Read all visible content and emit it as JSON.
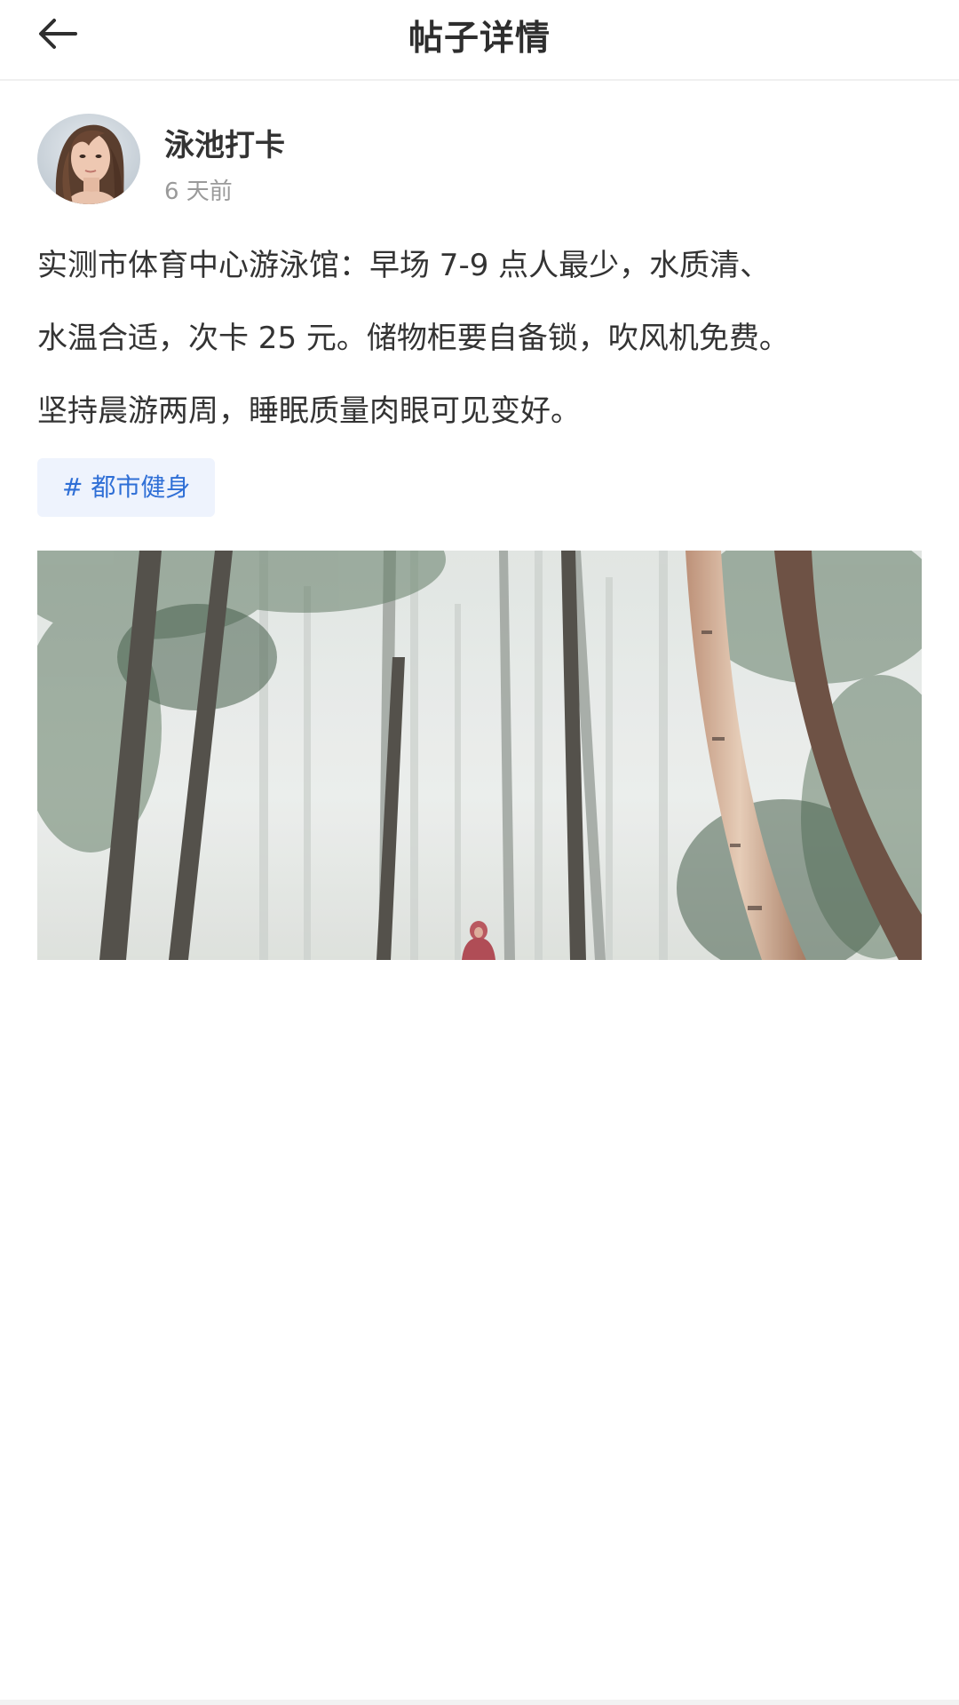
{
  "header": {
    "title": "帖子详情",
    "back_icon": "arrow-left-icon"
  },
  "author": {
    "name": "泳池打卡",
    "time": "6 天前"
  },
  "post": {
    "lines": [
      "实测市体育中心游泳馆：早场 7-9 点人最少，水质清、",
      "水温合适，次卡 25 元。储物柜要自备锁，吹风机免费。",
      "坚持晨游两周，睡眠质量肉眼可见变好。"
    ],
    "tag": "# 都市健身"
  },
  "colors": {
    "tag_text": "#2f6fd6",
    "tag_bg": "#eef3fd"
  }
}
